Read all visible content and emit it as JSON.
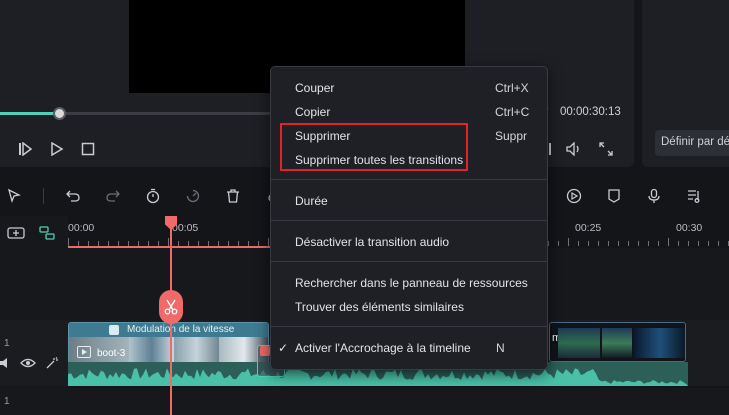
{
  "player": {
    "time_separator": "/",
    "total_time": "00:00:30:13",
    "progress_fraction": 0.21
  },
  "right_panel": {
    "default_button": "Définir par dé"
  },
  "ruler": {
    "ticks": [
      "00:00",
      "00:05",
      "00:25",
      "00:30"
    ]
  },
  "timeline": {
    "clip_left_title": "Modulation de la vitesse",
    "clip_left_name": "boot-3",
    "clip_right_label": "mora",
    "track_label_video": "1",
    "track_label_next": "1"
  },
  "context_menu": {
    "cut": "Couper",
    "cut_shortcut": "Ctrl+X",
    "copy": "Copier",
    "copy_shortcut": "Ctrl+C",
    "delete": "Supprimer",
    "delete_shortcut": "Suppr",
    "delete_all_transitions": "Supprimer toutes les transitions",
    "duration": "Durée",
    "disable_audio_transition": "Désactiver la transition audio",
    "search_resources": "Rechercher dans le panneau de ressources",
    "find_similar": "Trouver des éléments similaires",
    "check_mark": "✓",
    "enable_snapping": "Activer l'Accrochage à la timeline",
    "enable_snapping_shortcut": "N"
  },
  "colors": {
    "accent": "#4fd1b5",
    "playhead": "#f06a6a",
    "highlight": "#e3222b"
  }
}
